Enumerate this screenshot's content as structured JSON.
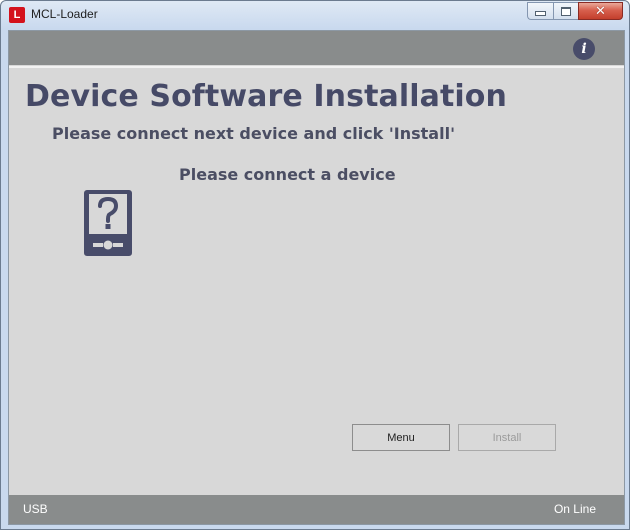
{
  "window": {
    "title": "MCL-Loader",
    "app_icon_letter": "L",
    "close_glyph": "✕"
  },
  "header": {
    "info_icon_glyph": "i"
  },
  "main": {
    "title": "Device Software Installation",
    "instruction": "Please connect next device and click 'Install'",
    "status": "Please connect a device",
    "device_icon": "unknown-device-icon"
  },
  "buttons": {
    "menu_label": "Menu",
    "install_label": "Install",
    "install_enabled": false
  },
  "statusbar": {
    "connection": "USB",
    "mode": "On Line"
  },
  "colors": {
    "title_text": "#464a67",
    "bar_gray": "#898c8c",
    "content_bg": "#d8d8d8",
    "icon_dark": "#484c6a",
    "app_icon_red": "#d4121c"
  }
}
